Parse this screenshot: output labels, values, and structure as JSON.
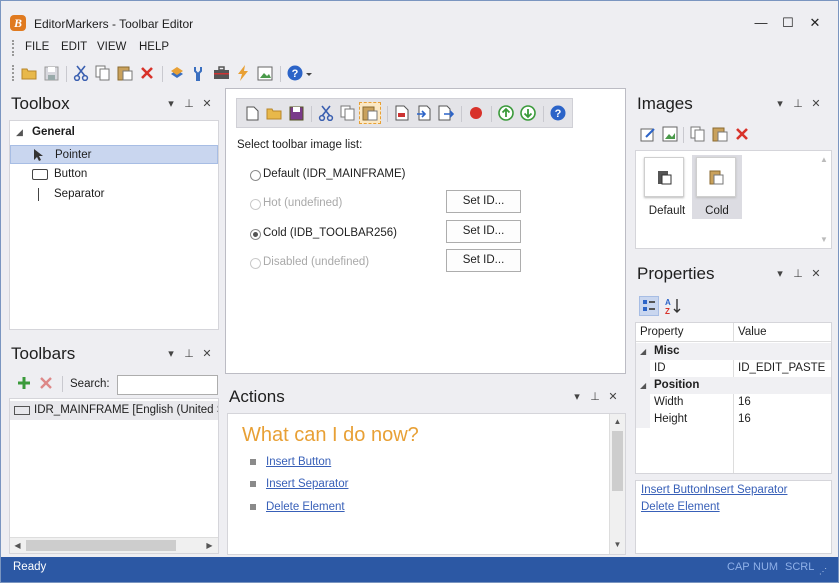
{
  "window": {
    "title": "EditorMarkers - Toolbar Editor",
    "app_icon": "B",
    "min": "—",
    "max": "☐",
    "close": "✕"
  },
  "menu": [
    "FILE",
    "EDIT",
    "VIEW",
    "HELP"
  ],
  "toolbox": {
    "title": "Toolbox",
    "group": "General",
    "items": [
      "Pointer",
      "Button",
      "Separator"
    ]
  },
  "toolbars": {
    "title": "Toolbars",
    "search_label": "Search:",
    "search_value": "",
    "items": [
      "IDR_MAINFRAME [English (United S"
    ]
  },
  "editor": {
    "select_label": "Select toolbar image list:",
    "options": [
      {
        "label": "Default (IDR_MAINFRAME)",
        "checked": false,
        "enabled": true,
        "button": ""
      },
      {
        "label": "Hot (undefined)",
        "checked": false,
        "enabled": false,
        "button": "Set ID..."
      },
      {
        "label": "Cold (IDB_TOOLBAR256)",
        "checked": true,
        "enabled": true,
        "button": "Set ID..."
      },
      {
        "label": "Disabled (undefined)",
        "checked": false,
        "enabled": false,
        "button": "Set ID..."
      }
    ]
  },
  "actions": {
    "title": "Actions",
    "heading": "What can I do now?",
    "links": [
      "Insert Button",
      "Insert Separator",
      "Delete Element"
    ]
  },
  "images": {
    "title": "Images",
    "items": [
      "Default",
      "Cold"
    ]
  },
  "properties": {
    "title": "Properties",
    "col_property": "Property",
    "col_value": "Value",
    "groups": [
      {
        "name": "Misc",
        "rows": [
          {
            "k": "ID",
            "v": "ID_EDIT_PASTE"
          }
        ]
      },
      {
        "name": "Position",
        "rows": [
          {
            "k": "Width",
            "v": "16"
          },
          {
            "k": "Height",
            "v": "16"
          }
        ]
      }
    ],
    "links": [
      "Insert Button",
      "Insert Separator",
      "Delete Element"
    ]
  },
  "status": {
    "text": "Ready",
    "indicators": [
      "CAP",
      "NUM",
      "SCRL"
    ]
  },
  "colors": {
    "accent": "#2c58a4",
    "orange": "#e8a035",
    "link": "#3860b8"
  }
}
